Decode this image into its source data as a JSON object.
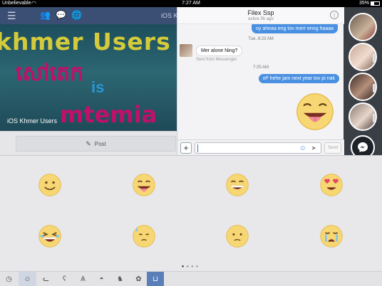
{
  "status_bar": {
    "carrier": "Unbelievable",
    "wifi_icon": "wifi-icon",
    "time": "7:27 AM",
    "battery_pct": "35%"
  },
  "top_nav": {
    "title": "iOS K",
    "icons": [
      "menu-icon",
      "friends-icon",
      "messages-icon",
      "globe-icon"
    ]
  },
  "cover": {
    "line1": "khmer Users",
    "line2": "សៅតេក",
    "line3": "is",
    "line4": "mtemia",
    "group_name": "iOS Khmer Users"
  },
  "post_bar": {
    "label": "Post"
  },
  "chat": {
    "contact_name": "Filex Ssp",
    "active_status": "active 5h ago",
    "messages": [
      {
        "direction": "out",
        "text": "oy aheaa eng tov merr enng haaaa"
      },
      {
        "type": "timestamp",
        "text": "Tue, 8:23 AM"
      },
      {
        "direction": "in",
        "text": "Mer alone Ning?"
      },
      {
        "type": "meta",
        "text": "Sent from Messenger"
      },
      {
        "type": "timestamp",
        "text": "7:25 AM"
      },
      {
        "direction": "out",
        "text": "xP hehe jam next year tov pi nak"
      }
    ],
    "input_placeholder": "",
    "send_label": "Send"
  },
  "chat_heads": {
    "messenger_icon": "messenger-icon",
    "count": 4
  },
  "sticker_keyboard": {
    "stickers": [
      "smile-sticker",
      "tongue-sticker",
      "grin-sticker",
      "heart-eyes-sticker",
      "laugh-tears-sticker",
      "sweat-sticker",
      "meh-sticker",
      "crying-sticker"
    ],
    "pages": 4,
    "current_page": 1,
    "tabs": [
      "recent-icon",
      "smiley-icon",
      "cat-icon",
      "bear-icon",
      "bunny-icon",
      "egg-icon",
      "bird-icon",
      "flower-icon",
      "cup-icon"
    ],
    "active_tab": 1
  }
}
